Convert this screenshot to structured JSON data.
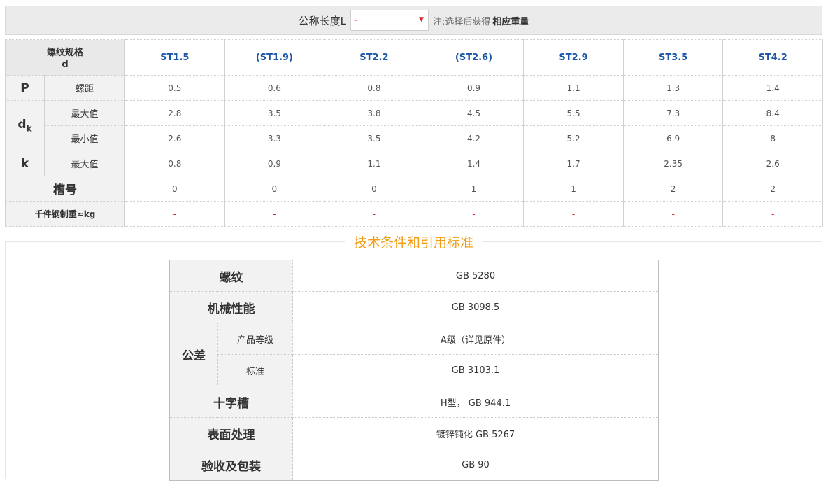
{
  "filter": {
    "label": "公称长度L",
    "select_value": "-",
    "note_prefix": "注:选择后获得",
    "note_bold": "相应重量"
  },
  "spec_table": {
    "corner_label_line1": "螺纹规格",
    "corner_label_line2": "d",
    "columns": [
      "ST1.5",
      "(ST1.9)",
      "ST2.2",
      "(ST2.6)",
      "ST2.9",
      "ST3.5",
      "ST4.2"
    ],
    "rows": {
      "p_symbol": "P",
      "p_label": "螺距",
      "p_values": [
        "0.5",
        "0.6",
        "0.8",
        "0.9",
        "1.1",
        "1.3",
        "1.4"
      ],
      "dk_symbol": "d",
      "dk_subscript": "k",
      "dk_max_label": "最大值",
      "dk_max_values": [
        "2.8",
        "3.5",
        "3.8",
        "4.5",
        "5.5",
        "7.3",
        "8.4"
      ],
      "dk_min_label": "最小值",
      "dk_min_values": [
        "2.6",
        "3.3",
        "3.5",
        "4.2",
        "5.2",
        "6.9",
        "8"
      ],
      "k_symbol": "k",
      "k_max_label": "最大值",
      "k_max_values": [
        "0.8",
        "0.9",
        "1.1",
        "1.4",
        "1.7",
        "2.35",
        "2.6"
      ],
      "slot_label": "槽号",
      "slot_values": [
        "0",
        "0",
        "0",
        "1",
        "1",
        "2",
        "2"
      ],
      "weight_label": "千件钢制重≈kg",
      "weight_values": [
        "-",
        "-",
        "-",
        "-",
        "-",
        "-",
        "-"
      ]
    }
  },
  "tech": {
    "title": "技术条件和引用标准",
    "thread_label": "螺纹",
    "thread_value": "GB 5280",
    "mech_label": "机械性能",
    "mech_value": "GB 3098.5",
    "tol_label": "公差",
    "grade_label": "产品等级",
    "grade_value": "A级（详见原件）",
    "std_label": "标准",
    "std_value": "GB 3103.1",
    "cross_label": "十字槽",
    "cross_value": "H型， GB 944.1",
    "surface_label": "表面处理",
    "surface_value": "镀锌钝化 GB 5267",
    "accept_label": "验收及包装",
    "accept_value": "GB 90"
  },
  "colors": {
    "accent_header": "#1a56a8",
    "dash_red": "#e02020",
    "title_orange": "#f39c12"
  }
}
